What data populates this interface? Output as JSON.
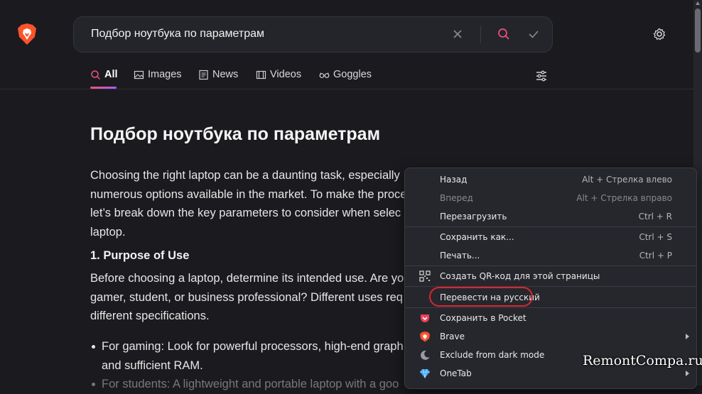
{
  "search": {
    "query": "Подбор ноутбука по параметрам"
  },
  "tabs": [
    {
      "label": "All",
      "icon": "search-icon",
      "active": true
    },
    {
      "label": "Images",
      "icon": "image-icon"
    },
    {
      "label": "News",
      "icon": "news-icon"
    },
    {
      "label": "Videos",
      "icon": "video-icon"
    },
    {
      "label": "Goggles",
      "icon": "goggles-icon"
    }
  ],
  "article": {
    "title": "Подбор ноутбука по параметрам",
    "intro_lines": [
      "Choosing the right laptop can be a daunting task, especially",
      "numerous options available in the market. To make the proce",
      "let’s break down the key parameters to consider when selec",
      "laptop."
    ],
    "section1_title": "1. Purpose of Use",
    "section1_lines": [
      "Before choosing a laptop, determine its intended use. Are yo",
      "gamer, student, or business professional? Different uses req",
      "different specifications."
    ],
    "bullet1_lines": [
      "For gaming: Look for powerful processors, high-end graph",
      "and sufficient RAM."
    ],
    "bullet2_line": "For students: A lightweight and portable laptop with a goo"
  },
  "context_menu": {
    "items": [
      {
        "label": "Назад",
        "shortcut": "Alt + Стрелка влево"
      },
      {
        "label": "Вперед",
        "shortcut": "Alt + Стрелка вправо",
        "disabled": true
      },
      {
        "label": "Перезагрузить",
        "shortcut": "Ctrl + R"
      },
      {
        "label": "Сохранить как...",
        "shortcut": "Ctrl + S"
      },
      {
        "label": "Печать...",
        "shortcut": "Ctrl + P"
      },
      {
        "label": "Создать QR-код для этой страницы",
        "icon": "qr-code-icon"
      },
      {
        "label": "Перевести на русский"
      },
      {
        "label": "Сохранить в Pocket",
        "icon": "pocket-icon"
      },
      {
        "label": "Brave",
        "icon": "brave-icon"
      },
      {
        "label": "Exclude from dark mode",
        "icon": "moon-icon"
      },
      {
        "label": "OneTab",
        "icon": "onetab-icon"
      }
    ]
  },
  "watermark": "RemontCompa.ru",
  "colors": {
    "accent": "#f0527a",
    "highlight_ring": "#d6282e",
    "brave_orange": "#fb542b",
    "pocket_red": "#ef4056"
  }
}
